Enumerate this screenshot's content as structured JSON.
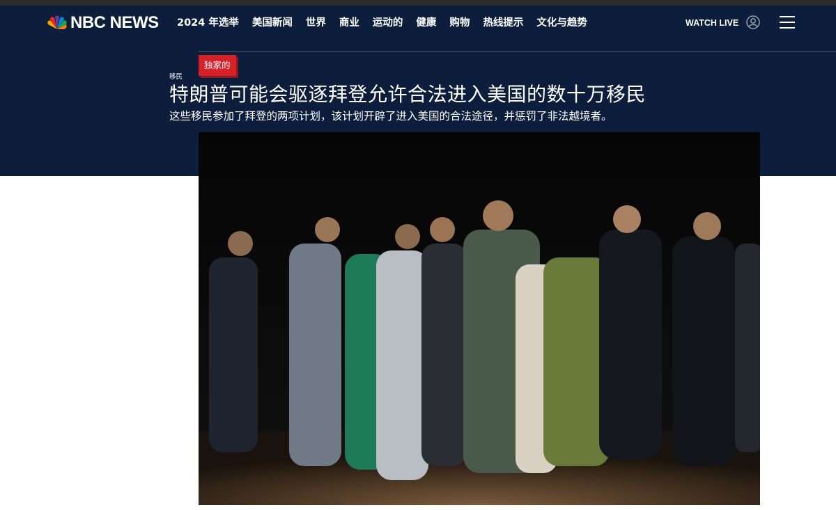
{
  "site": {
    "logo_text": "NBC NEWS",
    "logo_icon": "peacock-icon"
  },
  "nav": {
    "items": [
      {
        "label": "2024 年选举"
      },
      {
        "label": "美国新闻"
      },
      {
        "label": "世界"
      },
      {
        "label": "商业"
      },
      {
        "label": "运动的"
      },
      {
        "label": "健康"
      },
      {
        "label": "购物"
      },
      {
        "label": "热线提示"
      },
      {
        "label": "文化与趋势"
      }
    ],
    "watch_live": "WATCH LIVE",
    "account_icon": "user-account-icon",
    "menu_icon": "hamburger-menu-icon"
  },
  "article": {
    "badge": "独家的",
    "category": "移民",
    "headline": "特朗普可能会驱逐拜登允许合法进入美国的数十万移民",
    "dek": "这些移民参加了拜登的两项计划，该计划开辟了进入美国的合法途径，并惩罚了非法越境者。"
  },
  "colors": {
    "header_bg": "#0d1d3c",
    "badge_red": "#d6202a",
    "page_bg": "#ffffff"
  }
}
